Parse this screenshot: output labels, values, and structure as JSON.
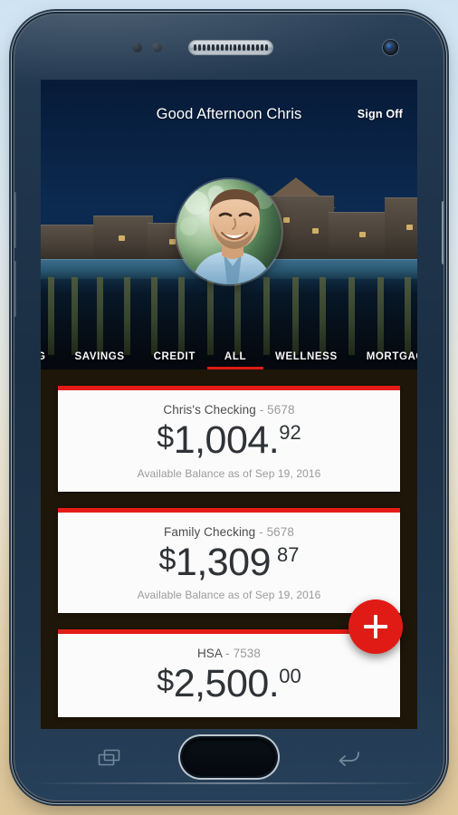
{
  "device": {
    "platform": "android-phone",
    "hardware": {
      "speaker": "earpiece-speaker",
      "front_camera": "front-camera",
      "home_button": "home-button",
      "recents_key": "recents-key",
      "back_key": "back-key"
    }
  },
  "header": {
    "greeting": "Good Afternoon Chris",
    "sign_off_label": "Sign Off"
  },
  "profile": {
    "avatar_alt": "Chris profile photo"
  },
  "tabs": {
    "items": [
      {
        "label": "G",
        "active": false,
        "clipped": "left"
      },
      {
        "label": "SAVINGS",
        "active": false,
        "clipped": ""
      },
      {
        "label": "CREDIT",
        "active": false,
        "clipped": ""
      },
      {
        "label": "ALL",
        "active": true,
        "clipped": ""
      },
      {
        "label": "WELLNESS",
        "active": false,
        "clipped": ""
      },
      {
        "label": "MORTGAG",
        "active": false,
        "clipped": "right"
      }
    ]
  },
  "accounts": {
    "items": [
      {
        "name": "Chris's Checking",
        "separator": " - ",
        "mask": "5678",
        "currency": "$",
        "whole": "1,004",
        "decimal_point": ".",
        "cents": "92",
        "available": "Available Balance as of Sep 19, 2016"
      },
      {
        "name": "Family Checking",
        "separator": " - ",
        "mask": "5678",
        "currency": "$",
        "whole": "1,309",
        "decimal_point": "",
        "cents": "87",
        "available": "Available Balance as of Sep 19, 2016"
      },
      {
        "name": "HSA",
        "separator": " - ",
        "mask": "7538",
        "currency": "$",
        "whole": "2,500",
        "decimal_point": ".",
        "cents": "00",
        "available": ""
      }
    ]
  },
  "fab": {
    "icon": "plus-icon",
    "label": "+"
  },
  "colors": {
    "accent_red": "#e41c17",
    "fab_red": "#e01b15",
    "card_bg": "#fbfbfb",
    "amount_text": "#2f3337",
    "muted_text": "#9b9b9b",
    "screen_dark": "#020f24",
    "list_bg": "#1e1608"
  }
}
